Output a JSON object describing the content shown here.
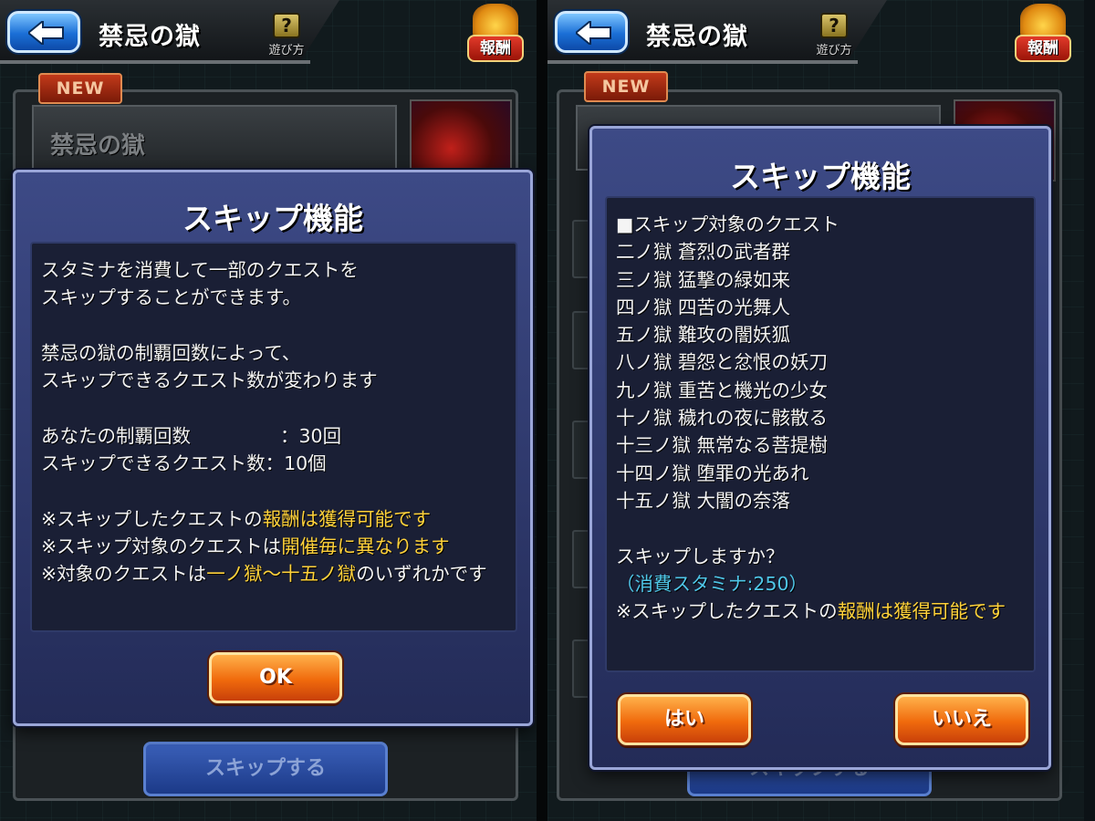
{
  "header": {
    "title": "禁忌の獄",
    "howto_label": "遊び方",
    "howto_icon": "?",
    "reward_label": "報酬"
  },
  "quest_panel": {
    "new_badge": "NEW",
    "banner_title": "禁忌の獄",
    "skip_button_label": "スキップする"
  },
  "dialog_info": {
    "title": "スキップ機能",
    "lines": {
      "l1": "スタミナを消費して一部のクエストを",
      "l2": "スキップすることができます。",
      "l3": "禁忌の獄の制覇回数によって、",
      "l4": "スキップできるクエスト数が変わります",
      "clears_label": "あなたの制覇回数",
      "clears_value": "：30回",
      "skippable_label": "スキップできるクエスト数",
      "skippable_value": "：10個",
      "note1_pre": "※スキップしたクエストの",
      "note1_hl": "報酬は獲得可能です",
      "note2_pre": "※スキップ対象のクエストは",
      "note2_hl": "開催毎に異なります",
      "note3_pre": "※対象のクエストは",
      "note3_hl": "一ノ獄〜十五ノ獄",
      "note3_post": "のいずれかです"
    },
    "ok_label": "OK"
  },
  "dialog_confirm": {
    "title": "スキップ機能",
    "list_header": "■スキップ対象のクエスト",
    "quests": [
      "二ノ獄 蒼烈の武者群",
      "三ノ獄 猛撃の緑如来",
      "四ノ獄 四苦の光舞人",
      "五ノ獄 難攻の闇妖狐",
      "八ノ獄 碧怨と忿恨の妖刀",
      "九ノ獄 重苦と機光の少女",
      "十ノ獄 穢れの夜に骸散る",
      "十三ノ獄 無常なる菩提樹",
      "十四ノ獄 堕罪の光あれ",
      "十五ノ獄 大闇の奈落"
    ],
    "question": "スキップしますか？",
    "stamina_cost": "（消費スタミナ:250）",
    "note_pre": "※スキップしたクエストの",
    "note_hl": "報酬は獲得可能です",
    "yes_label": "はい",
    "no_label": "いいえ"
  },
  "colors": {
    "highlight": "#ffd23a",
    "cyan": "#4fc6e8",
    "button_orange": "#f06a0c",
    "dialog_blue": "#2f3a6e"
  }
}
